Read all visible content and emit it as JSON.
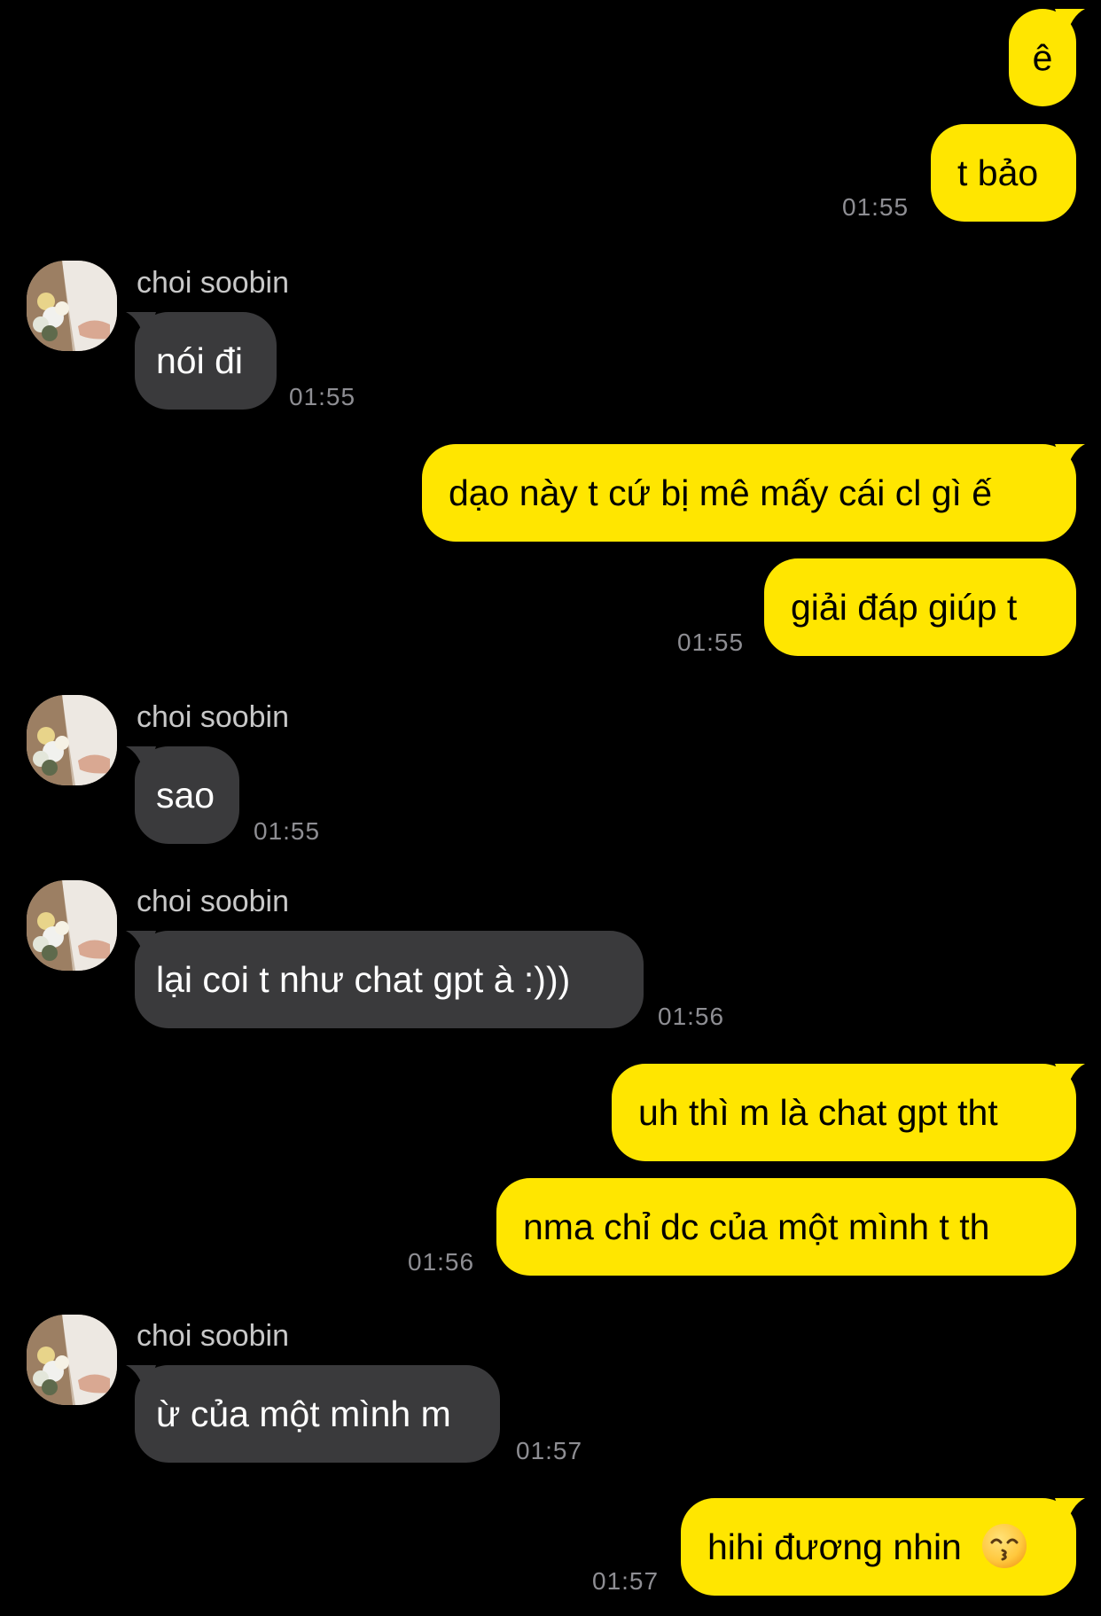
{
  "contact": {
    "name": "choi soobin"
  },
  "colors": {
    "background": "#000000",
    "outgoing_bubble": "#FFE600",
    "incoming_bubble": "#3A3A3C",
    "timestamp": "#8E8E93"
  },
  "messages": [
    {
      "direction": "out",
      "text": "ê"
    },
    {
      "direction": "out",
      "text": "t bảo",
      "time": "01:55"
    },
    {
      "direction": "in",
      "sender": "choi soobin",
      "text": "nói đi",
      "time": "01:55"
    },
    {
      "direction": "out",
      "text": "dạo này t cứ bị mê mấy cái cl gì ế"
    },
    {
      "direction": "out",
      "text": "giải đáp giúp t",
      "time": "01:55"
    },
    {
      "direction": "in",
      "sender": "choi soobin",
      "text": "sao",
      "time": "01:55"
    },
    {
      "direction": "in",
      "sender": "choi soobin",
      "text": "lại coi t như chat gpt à :)))",
      "time": "01:56"
    },
    {
      "direction": "out",
      "text": "uh thì m là chat gpt tht"
    },
    {
      "direction": "out",
      "text": "nma chỉ dc của một mình t th",
      "time": "01:56"
    },
    {
      "direction": "in",
      "sender": "choi soobin",
      "text": "ừ của một mình m",
      "time": "01:57"
    },
    {
      "direction": "out",
      "text": "hihi đương nhin",
      "emoji": "kissing-face-with-smiling-eyes-icon",
      "time": "01:57"
    }
  ]
}
